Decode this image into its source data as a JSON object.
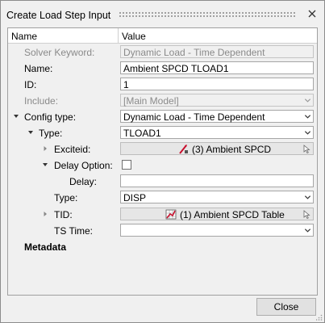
{
  "window": {
    "title": "Create Load Step Input"
  },
  "header": {
    "name": "Name",
    "value": "Value"
  },
  "rows": {
    "solver_keyword": {
      "label": "Solver Keyword:",
      "value": "Dynamic Load - Time Dependent"
    },
    "name": {
      "label": "Name:",
      "value": "Ambient SPCD TLOAD1"
    },
    "id": {
      "label": "ID:",
      "value": "1"
    },
    "include": {
      "label": "Include:",
      "value": "[Main Model]"
    },
    "config_type": {
      "label": "Config type:",
      "value": "Dynamic Load - Time Dependent"
    },
    "type": {
      "label": "Type:",
      "value": "TLOAD1"
    },
    "exciteid": {
      "label": "Exciteid:",
      "value": "(3) Ambient SPCD"
    },
    "delay_option": {
      "label": "Delay Option:",
      "checked": false
    },
    "delay": {
      "label": "Delay:",
      "value": ""
    },
    "type2": {
      "label": "Type:",
      "value": "DISP"
    },
    "tid": {
      "label": "TID:",
      "value": "(1) Ambient SPCD Table"
    },
    "ts_time": {
      "label": "TS Time:",
      "value": ""
    },
    "metadata": {
      "label": "Metadata"
    }
  },
  "buttons": {
    "close": "Close"
  },
  "colors": {
    "background": "#f0f0f0",
    "field_border": "#a6a6a6",
    "disabled_text": "#8a8a8a",
    "icon_red": "#c8102e"
  }
}
